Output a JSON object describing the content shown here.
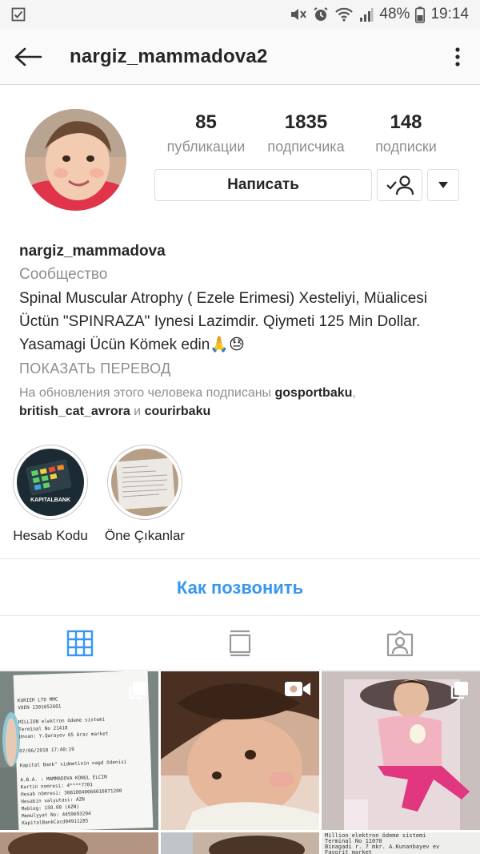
{
  "status_bar": {
    "battery": "48%",
    "time": "19:14"
  },
  "header": {
    "title": "nargiz_mammadova2"
  },
  "stats": [
    {
      "value": "85",
      "label": "публикации"
    },
    {
      "value": "1835",
      "label": "подписчика"
    },
    {
      "value": "148",
      "label": "подписки"
    }
  ],
  "actions": {
    "message_label": "Написать"
  },
  "bio": {
    "name": "nargiz_mammadova",
    "category": "Сообщество",
    "text": "Spinal Muscular Atrophy ( Ezele Erimesi) Xesteliyi, Müalicesi Üctün \"SPINRAZA\" Iynesi Lazimdir. Qiymeti 125 Min Dollar. Yasamagi Ücün Kömek edin🙏😓",
    "translate": "ПОКАЗАТЬ ПЕРЕВОД",
    "followed_prefix": "На обновления этого человека подписаны ",
    "followed_user1": "gosportbaku",
    "followed_sep": ", ",
    "followed_user2": "british_cat_avrora",
    "followed_and": " и ",
    "followed_user3": "courirbaku"
  },
  "highlights": [
    {
      "label": "Hesab Kodu",
      "image_text": "KAPITALBANK"
    },
    {
      "label": "Öne Çıkanlar"
    }
  ],
  "call_link": "Как позвонить",
  "receipt": {
    "lines": "KURIER LTD MMC\nVOEN 1301652601\n\nMILLION elektron ödeme sistemi\nTerminal No 21418\nUnvan: Y.Qarayev 65 Araz market\n\n07/06/2018 17:40:19\n\nKapital Bank\" xidmetinin nagd ödenisi\n\nA.B.A. : MAMMADOVA KONUL ELCIN\nKartin nomresi: 4****7701\nHesab nömresi: 38810040066010071200\nHesabin valyutasi: AZN\nMebleg: 150.00 (AZN)\nMemulyyat No: 4459693204\nKapitalBankCacd04911285\n\nZahir edirik, mebleg hesabiniza\nköçürülecekdir qebzi saxlayin\n\n24/7 Cagri Merkezi: *0010\nQebul: 5 gun, 09:00-18:00\nSenbe: 09:00-14:00-det\ninfo@million.az\nwww.million.az",
    "bottom_lines": "Million elektron ödeme sistemi\nTerminal No 11070\nBinagadi r. 7 mkr. A.Kunanbayev ev\nFavorit market"
  },
  "colors": {
    "link": "#3897f0",
    "muted": "#8e8e8e",
    "text": "#262626"
  }
}
